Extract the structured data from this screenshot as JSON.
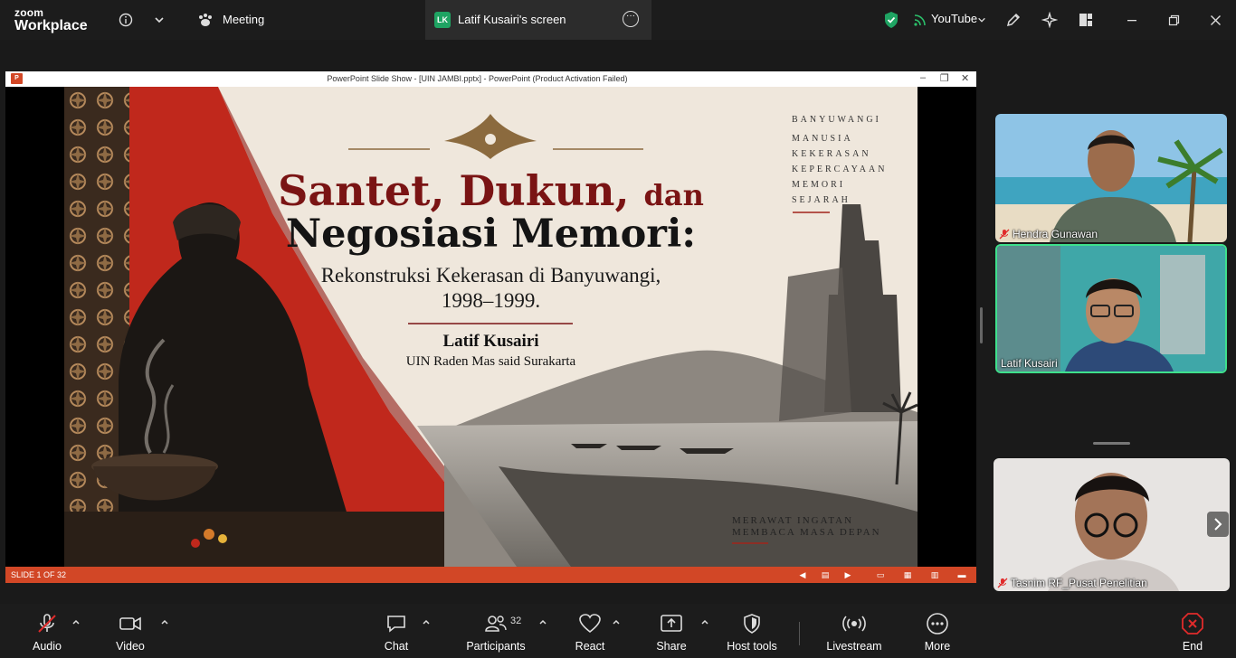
{
  "app": {
    "brand_line1": "zoom",
    "brand_line2": "Workplace"
  },
  "topbar": {
    "meeting_label": "Meeting",
    "share_tab": {
      "initials": "LK",
      "label": "Latif Kusairi's screen"
    },
    "youtube_label": "YouTube"
  },
  "share_window": {
    "title": "PowerPoint Slide Show - [UIN JAMBI.pptx] - PowerPoint (Product Activation Failed)",
    "status": "SLIDE 1 OF 32"
  },
  "slide": {
    "title_part1": "Santet, Dukun,",
    "title_dan": "dan",
    "title_line2": "Negosiasi Memori:",
    "subtitle_line1": "Rekonstruksi Kekerasan di Banyuwangi,",
    "subtitle_line2": "1998–1999.",
    "author": "Latif Kusairi",
    "institution": "UIN Raden Mas said Surakarta",
    "right_words": [
      "BANYUWANGI",
      "MANUSIA",
      "KEKERASAN",
      "KEPERCAYAAN",
      "MEMORI",
      "SEJARAH"
    ],
    "footer_line1": "MERAWAT INGATAN",
    "footer_line2": "MEMBACA MASA DEPAN"
  },
  "participants_tiles": [
    {
      "name": "Hendra Gunawan",
      "muted": true
    },
    {
      "name": "Latif Kusairi",
      "muted": false,
      "active_speaker": true
    },
    {
      "name": "Tasnim RF_Pusat Penelitian",
      "muted": true
    }
  ],
  "toolbar": {
    "audio": "Audio",
    "video": "Video",
    "chat": "Chat",
    "participants": "Participants",
    "participants_count": "32",
    "react": "React",
    "share": "Share",
    "host_tools": "Host tools",
    "livestream": "Livestream",
    "more": "More",
    "end": "End"
  },
  "colors": {
    "accent_green": "#1fa463",
    "pp_red": "#d24726",
    "end_red": "#e02b2b",
    "title_red": "#7a1414"
  }
}
